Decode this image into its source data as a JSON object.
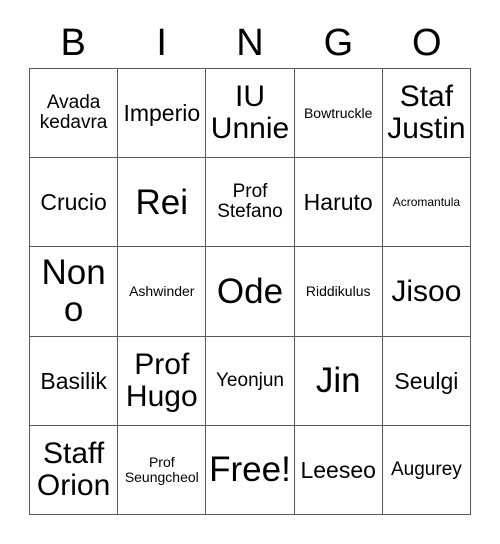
{
  "card": {
    "title": "BINGO",
    "headers": [
      "B",
      "I",
      "N",
      "G",
      "O"
    ],
    "grid_line_color": "#5a5a5a",
    "background_color": "#ffffff",
    "text_color": "#000000",
    "rows": [
      [
        {
          "text": "Avada\nkedavra",
          "size": "sm"
        },
        {
          "text": "Imperio",
          "size": "md"
        },
        {
          "text": "IU\nUnnie",
          "size": "lg"
        },
        {
          "text": "Bowtruckle",
          "size": "xs"
        },
        {
          "text": "Staf\nJustin",
          "size": "lg"
        }
      ],
      [
        {
          "text": "Crucio",
          "size": "md"
        },
        {
          "text": "Rei",
          "size": "xl"
        },
        {
          "text": "Prof\nStefano",
          "size": "sm"
        },
        {
          "text": "Haruto",
          "size": "md"
        },
        {
          "text": "Acromantula",
          "size": "xxs"
        }
      ],
      [
        {
          "text": "Nono",
          "size": "xl"
        },
        {
          "text": "Ashwinder",
          "size": "xs"
        },
        {
          "text": "Ode",
          "size": "xl"
        },
        {
          "text": "Riddikulus",
          "size": "xs"
        },
        {
          "text": "Jisoo",
          "size": "lg"
        }
      ],
      [
        {
          "text": "Basilik",
          "size": "md"
        },
        {
          "text": "Prof\nHugo",
          "size": "lg"
        },
        {
          "text": "Yeonjun",
          "size": "sm"
        },
        {
          "text": "Jin",
          "size": "xl"
        },
        {
          "text": "Seulgi",
          "size": "md"
        }
      ],
      [
        {
          "text": "Staff\nOrion",
          "size": "lg"
        },
        {
          "text": "Prof\nSeungcheol",
          "size": "xs"
        },
        {
          "text": "Free!",
          "size": "xl"
        },
        {
          "text": "Leeseo",
          "size": "md"
        },
        {
          "text": "Augurey",
          "size": "sm"
        }
      ]
    ]
  }
}
